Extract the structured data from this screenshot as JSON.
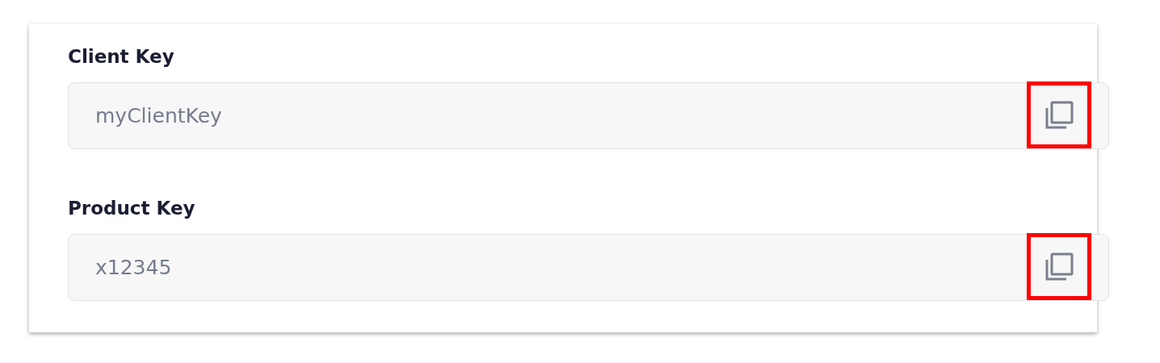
{
  "fields": [
    {
      "label": "Client Key",
      "value": "myClientKey",
      "copy_highlighted": true
    },
    {
      "label": "Product Key",
      "value": "x12345",
      "copy_highlighted": true
    }
  ]
}
